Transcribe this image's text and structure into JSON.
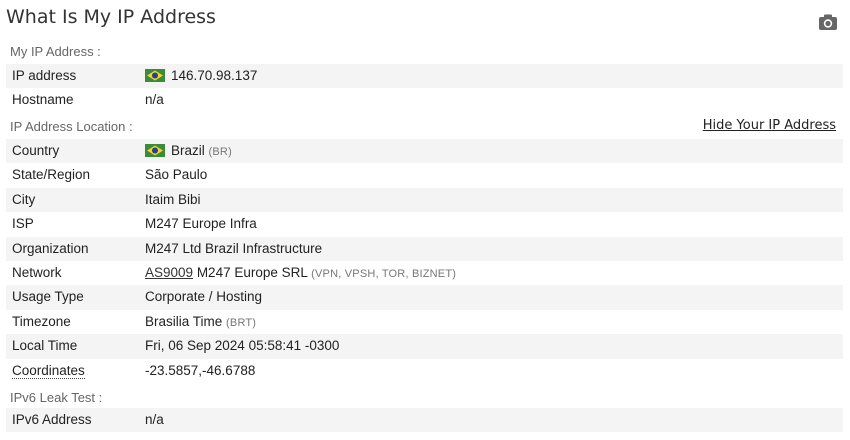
{
  "page": {
    "title": "What Is My IP Address",
    "camera_icon": "camera-icon"
  },
  "sections": {
    "my_ip": "My IP Address :",
    "location": "IP Address Location :",
    "ipv6": "IPv6 Leak Test :"
  },
  "links": {
    "hide_ip": "Hide Your IP Address"
  },
  "my_ip": {
    "ip_label": "IP address",
    "ip_value": "146.70.98.137",
    "hostname_label": "Hostname",
    "hostname_value": "n/a",
    "flag_icon": "brazil-flag-icon"
  },
  "location": {
    "country_label": "Country",
    "country_value": "Brazil",
    "country_code": "(BR)",
    "state_label": "State/Region",
    "state_value": "São Paulo",
    "city_label": "City",
    "city_value": "Itaim Bibi",
    "isp_label": "ISP",
    "isp_value": "M247 Europe Infra",
    "org_label": "Organization",
    "org_value": "M247 Ltd Brazil Infrastructure",
    "network_label": "Network",
    "network_as": "AS9009",
    "network_name": "M247 Europe SRL",
    "network_tags": "(VPN, VPSH, TOR, BIZNET)",
    "usage_label": "Usage Type",
    "usage_value": "Corporate / Hosting",
    "tz_label": "Timezone",
    "tz_value": "Brasilia Time",
    "tz_code": "(BRT)",
    "time_label": "Local Time",
    "time_value": "Fri, 06 Sep 2024 05:58:41 -0300",
    "coord_label": "Coordinates",
    "coord_value": "-23.5857,-46.6788"
  },
  "ipv6": {
    "label": "IPv6 Address",
    "value": "n/a"
  },
  "colors": {
    "flag_green": "#3a8c3a",
    "flag_yellow": "#f2d230",
    "flag_blue": "#2a3f8f",
    "row_shade": "#f4f4f4"
  }
}
